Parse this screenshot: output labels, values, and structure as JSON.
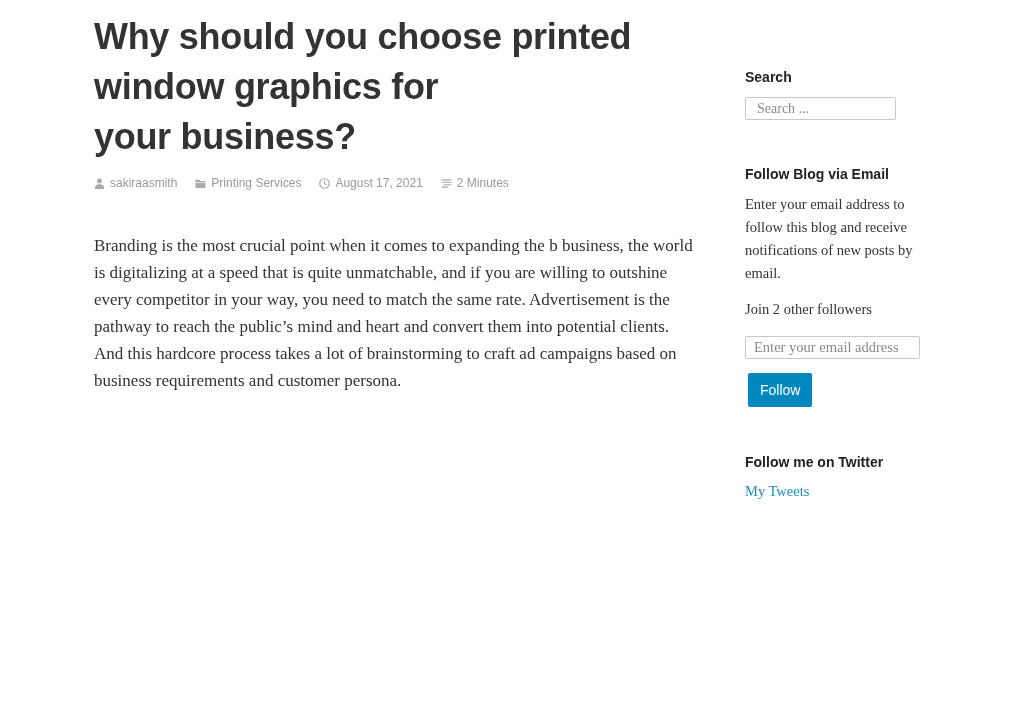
{
  "post": {
    "title_lines": [
      "Why should you choose printed",
      "window graphics for",
      "your business?"
    ],
    "meta": [
      {
        "kind": "author",
        "text": "sakiraasmith"
      },
      {
        "kind": "category",
        "text": "Printing Services"
      },
      {
        "kind": "date",
        "text": "August 17, 2021"
      },
      {
        "kind": "reading_time",
        "text": "2 Minutes"
      }
    ],
    "body": "Branding is the most crucial point when it comes to expanding the b business, the world is digitalizing at a speed that is quite unmatchable, and if you are willing to outshine every competitor in your way, you need to match the same rate. Advertisement is the pathway to reach the public’s mind and heart and convert them into potential clients. And this hardcore process takes a lot of brainstorming to craft ad campaigns based on business requirements and customer persona."
  },
  "sidebar": {
    "search": {
      "heading": "Search",
      "placeholder": "Search ..."
    },
    "follow": {
      "heading": "Follow Blog via Email",
      "description": "Enter your email address to follow this blog and receive notifications of new posts by email.",
      "followers": "Join 2 other followers",
      "email_placeholder": "Enter your email address",
      "button": "Follow"
    },
    "twitter": {
      "heading": "Follow me on Twitter",
      "link": "My Tweets"
    }
  }
}
